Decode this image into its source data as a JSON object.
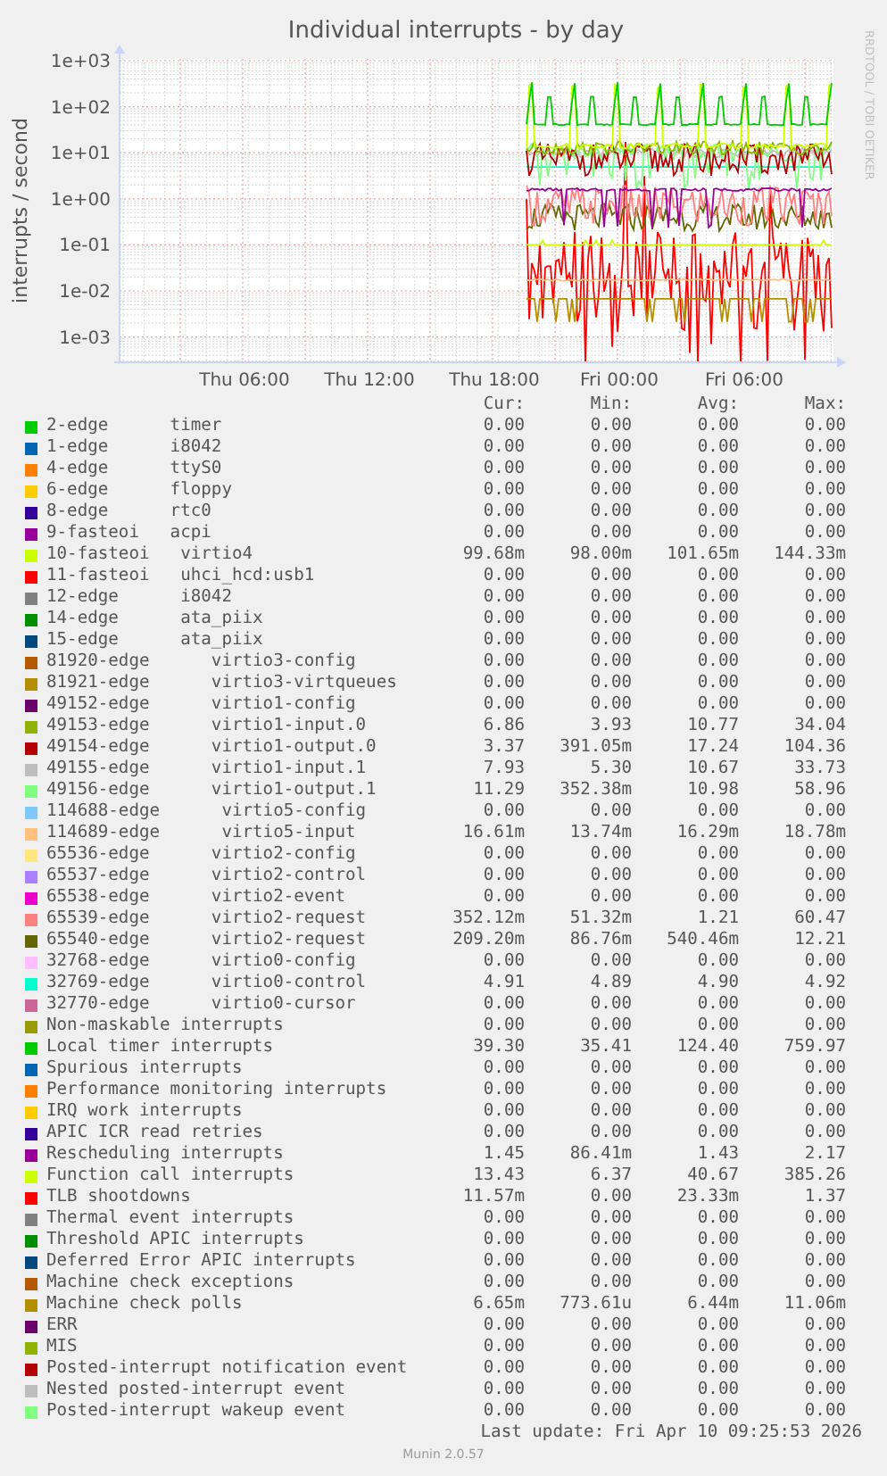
{
  "title": "Individual interrupts - by day",
  "y_axis_label": "interrupts / second",
  "side_label": "RRDTOOL / TOBI OETIKER",
  "y_tick_labels": [
    "1e+03",
    "1e+02",
    "1e+01",
    "1e+00",
    "1e-01",
    "1e-02",
    "1e-03"
  ],
  "x_tick_labels": [
    "Thu 06:00",
    "Thu 12:00",
    "Thu 18:00",
    "Fri 00:00",
    "Fri 06:00"
  ],
  "legend": {
    "headers": [
      "Cur:",
      "Min:",
      "Avg:",
      "Max:"
    ],
    "rows": [
      {
        "color": "#00cc00",
        "label": "2-edge      timer",
        "cur": "0.00",
        "min": "0.00",
        "avg": "0.00",
        "max": "0.00"
      },
      {
        "color": "#0066b3",
        "label": "1-edge      i8042",
        "cur": "0.00",
        "min": "0.00",
        "avg": "0.00",
        "max": "0.00"
      },
      {
        "color": "#ff8000",
        "label": "4-edge      ttyS0",
        "cur": "0.00",
        "min": "0.00",
        "avg": "0.00",
        "max": "0.00"
      },
      {
        "color": "#ffcc00",
        "label": "6-edge      floppy",
        "cur": "0.00",
        "min": "0.00",
        "avg": "0.00",
        "max": "0.00"
      },
      {
        "color": "#330099",
        "label": "8-edge      rtc0",
        "cur": "0.00",
        "min": "0.00",
        "avg": "0.00",
        "max": "0.00"
      },
      {
        "color": "#990099",
        "label": "9-fasteoi   acpi",
        "cur": "0.00",
        "min": "0.00",
        "avg": "0.00",
        "max": "0.00"
      },
      {
        "color": "#ccff00",
        "label": "10-fasteoi   virtio4",
        "cur": "99.68m",
        "min": "98.00m",
        "avg": "101.65m",
        "max": "144.33m"
      },
      {
        "color": "#ff0000",
        "label": "11-fasteoi   uhci_hcd:usb1",
        "cur": "0.00",
        "min": "0.00",
        "avg": "0.00",
        "max": "0.00"
      },
      {
        "color": "#808080",
        "label": "12-edge      i8042",
        "cur": "0.00",
        "min": "0.00",
        "avg": "0.00",
        "max": "0.00"
      },
      {
        "color": "#008f00",
        "label": "14-edge      ata_piix",
        "cur": "0.00",
        "min": "0.00",
        "avg": "0.00",
        "max": "0.00"
      },
      {
        "color": "#00487d",
        "label": "15-edge      ata_piix",
        "cur": "0.00",
        "min": "0.00",
        "avg": "0.00",
        "max": "0.00"
      },
      {
        "color": "#b35a00",
        "label": "81920-edge      virtio3-config",
        "cur": "0.00",
        "min": "0.00",
        "avg": "0.00",
        "max": "0.00"
      },
      {
        "color": "#b38f00",
        "label": "81921-edge      virtio3-virtqueues",
        "cur": "0.00",
        "min": "0.00",
        "avg": "0.00",
        "max": "0.00"
      },
      {
        "color": "#6b006b",
        "label": "49152-edge      virtio1-config",
        "cur": "0.00",
        "min": "0.00",
        "avg": "0.00",
        "max": "0.00"
      },
      {
        "color": "#8fb300",
        "label": "49153-edge      virtio1-input.0",
        "cur": "6.86",
        "min": "3.93",
        "avg": "10.77",
        "max": "34.04"
      },
      {
        "color": "#b30000",
        "label": "49154-edge      virtio1-output.0",
        "cur": "3.37",
        "min": "391.05m",
        "avg": "17.24",
        "max": "104.36"
      },
      {
        "color": "#bebebe",
        "label": "49155-edge      virtio1-input.1",
        "cur": "7.93",
        "min": "5.30",
        "avg": "10.67",
        "max": "33.73"
      },
      {
        "color": "#80ff80",
        "label": "49156-edge      virtio1-output.1",
        "cur": "11.29",
        "min": "352.38m",
        "avg": "10.98",
        "max": "58.96"
      },
      {
        "color": "#80c9ff",
        "label": "114688-edge      virtio5-config",
        "cur": "0.00",
        "min": "0.00",
        "avg": "0.00",
        "max": "0.00"
      },
      {
        "color": "#ffc080",
        "label": "114689-edge      virtio5-input",
        "cur": "16.61m",
        "min": "13.74m",
        "avg": "16.29m",
        "max": "18.78m"
      },
      {
        "color": "#ffe680",
        "label": "65536-edge      virtio2-config",
        "cur": "0.00",
        "min": "0.00",
        "avg": "0.00",
        "max": "0.00"
      },
      {
        "color": "#aa80ff",
        "label": "65537-edge      virtio2-control",
        "cur": "0.00",
        "min": "0.00",
        "avg": "0.00",
        "max": "0.00"
      },
      {
        "color": "#ee00cc",
        "label": "65538-edge      virtio2-event",
        "cur": "0.00",
        "min": "0.00",
        "avg": "0.00",
        "max": "0.00"
      },
      {
        "color": "#ff8080",
        "label": "65539-edge      virtio2-request",
        "cur": "352.12m",
        "min": "51.32m",
        "avg": "1.21",
        "max": "60.47"
      },
      {
        "color": "#666600",
        "label": "65540-edge      virtio2-request",
        "cur": "209.20m",
        "min": "86.76m",
        "avg": "540.46m",
        "max": "12.21"
      },
      {
        "color": "#ffbfff",
        "label": "32768-edge      virtio0-config",
        "cur": "0.00",
        "min": "0.00",
        "avg": "0.00",
        "max": "0.00"
      },
      {
        "color": "#00ffcc",
        "label": "32769-edge      virtio0-control",
        "cur": "4.91",
        "min": "4.89",
        "avg": "4.90",
        "max": "4.92"
      },
      {
        "color": "#cc6699",
        "label": "32770-edge      virtio0-cursor",
        "cur": "0.00",
        "min": "0.00",
        "avg": "0.00",
        "max": "0.00"
      },
      {
        "color": "#999900",
        "label": "Non-maskable interrupts",
        "cur": "0.00",
        "min": "0.00",
        "avg": "0.00",
        "max": "0.00"
      },
      {
        "color": "#00cc00",
        "label": "Local timer interrupts",
        "cur": "39.30",
        "min": "35.41",
        "avg": "124.40",
        "max": "759.97"
      },
      {
        "color": "#0066b3",
        "label": "Spurious interrupts",
        "cur": "0.00",
        "min": "0.00",
        "avg": "0.00",
        "max": "0.00"
      },
      {
        "color": "#ff8000",
        "label": "Performance monitoring interrupts",
        "cur": "0.00",
        "min": "0.00",
        "avg": "0.00",
        "max": "0.00"
      },
      {
        "color": "#ffcc00",
        "label": "IRQ work interrupts",
        "cur": "0.00",
        "min": "0.00",
        "avg": "0.00",
        "max": "0.00"
      },
      {
        "color": "#330099",
        "label": "APIC ICR read retries",
        "cur": "0.00",
        "min": "0.00",
        "avg": "0.00",
        "max": "0.00"
      },
      {
        "color": "#990099",
        "label": "Rescheduling interrupts",
        "cur": "1.45",
        "min": "86.41m",
        "avg": "1.43",
        "max": "2.17"
      },
      {
        "color": "#ccff00",
        "label": "Function call interrupts",
        "cur": "13.43",
        "min": "6.37",
        "avg": "40.67",
        "max": "385.26"
      },
      {
        "color": "#ff0000",
        "label": "TLB shootdowns",
        "cur": "11.57m",
        "min": "0.00",
        "avg": "23.33m",
        "max": "1.37"
      },
      {
        "color": "#808080",
        "label": "Thermal event interrupts",
        "cur": "0.00",
        "min": "0.00",
        "avg": "0.00",
        "max": "0.00"
      },
      {
        "color": "#008f00",
        "label": "Threshold APIC interrupts",
        "cur": "0.00",
        "min": "0.00",
        "avg": "0.00",
        "max": "0.00"
      },
      {
        "color": "#00487d",
        "label": "Deferred Error APIC interrupts",
        "cur": "0.00",
        "min": "0.00",
        "avg": "0.00",
        "max": "0.00"
      },
      {
        "color": "#b35a00",
        "label": "Machine check exceptions",
        "cur": "0.00",
        "min": "0.00",
        "avg": "0.00",
        "max": "0.00"
      },
      {
        "color": "#b38f00",
        "label": "Machine check polls",
        "cur": "6.65m",
        "min": "773.61u",
        "avg": "6.44m",
        "max": "11.06m"
      },
      {
        "color": "#6b006b",
        "label": "ERR",
        "cur": "0.00",
        "min": "0.00",
        "avg": "0.00",
        "max": "0.00"
      },
      {
        "color": "#8fb300",
        "label": "MIS",
        "cur": "0.00",
        "min": "0.00",
        "avg": "0.00",
        "max": "0.00"
      },
      {
        "color": "#b30000",
        "label": "Posted-interrupt notification event",
        "cur": "0.00",
        "min": "0.00",
        "avg": "0.00",
        "max": "0.00"
      },
      {
        "color": "#bebebe",
        "label": "Nested posted-interrupt event",
        "cur": "0.00",
        "min": "0.00",
        "avg": "0.00",
        "max": "0.00"
      },
      {
        "color": "#80ff80",
        "label": "Posted-interrupt wakeup event",
        "cur": "0.00",
        "min": "0.00",
        "avg": "0.00",
        "max": "0.00"
      }
    ]
  },
  "last_update": "Last update: Fri Apr 10 09:25:53 2026",
  "footer": "Munin 2.0.57"
}
